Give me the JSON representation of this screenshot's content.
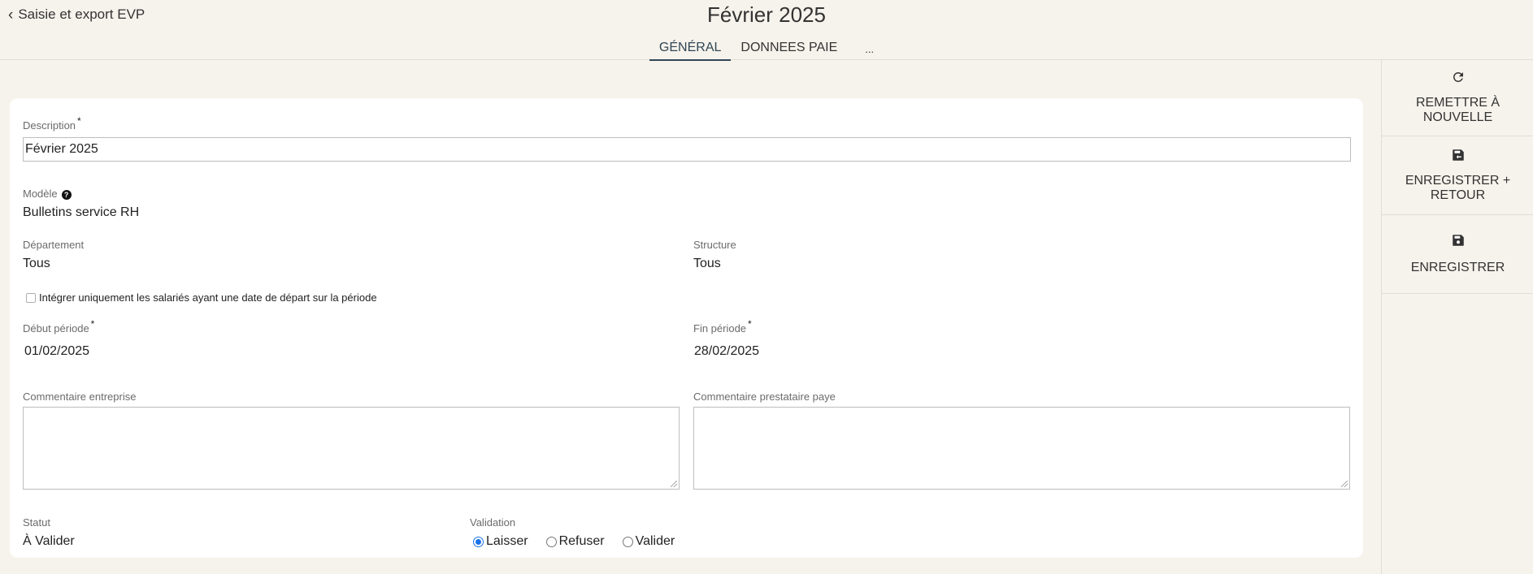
{
  "header": {
    "back_label": "Saisie et export EVP",
    "title": "Février 2025",
    "tabs": [
      {
        "label": "GÉNÉRAL"
      },
      {
        "label": "DONNEES PAIE"
      },
      {
        "label": "..."
      }
    ]
  },
  "form": {
    "description": {
      "label": "Description",
      "required": "*",
      "value": "Février 2025"
    },
    "modele": {
      "label": "Modèle",
      "help": "?",
      "value": "Bulletins service RH"
    },
    "departement": {
      "label": "Département",
      "value": "Tous"
    },
    "structure": {
      "label": "Structure",
      "value": "Tous"
    },
    "checkbox_label": "Intégrer uniquement les salariés ayant une date de départ sur la période",
    "debut": {
      "label": "Début période",
      "required": "*",
      "value": "01/02/2025"
    },
    "fin": {
      "label": "Fin période",
      "required": "*",
      "value": "28/02/2025"
    },
    "comment_entreprise": {
      "label": "Commentaire entreprise"
    },
    "comment_prestataire": {
      "label": "Commentaire prestataire paye"
    },
    "statut": {
      "label": "Statut",
      "value": "À Valider"
    },
    "validation": {
      "label": "Validation",
      "options": [
        {
          "label": "Laisser",
          "selected": true
        },
        {
          "label": "Refuser",
          "selected": false
        },
        {
          "label": "Valider",
          "selected": false
        }
      ]
    }
  },
  "sidebar": {
    "actions": [
      {
        "label_line1": "REMETTRE À",
        "label_line2": "NOUVELLE",
        "icon": "refresh-icon"
      },
      {
        "label_line1": "ENREGISTRER +",
        "label_line2": "RETOUR",
        "icon": "save-return-icon"
      },
      {
        "label_line1": "ENREGISTRER",
        "label_line2": "",
        "icon": "save-icon"
      }
    ]
  },
  "colors": {
    "background": "#f6f3ec",
    "accent": "#2f4654",
    "radio": "#1a73e8"
  }
}
